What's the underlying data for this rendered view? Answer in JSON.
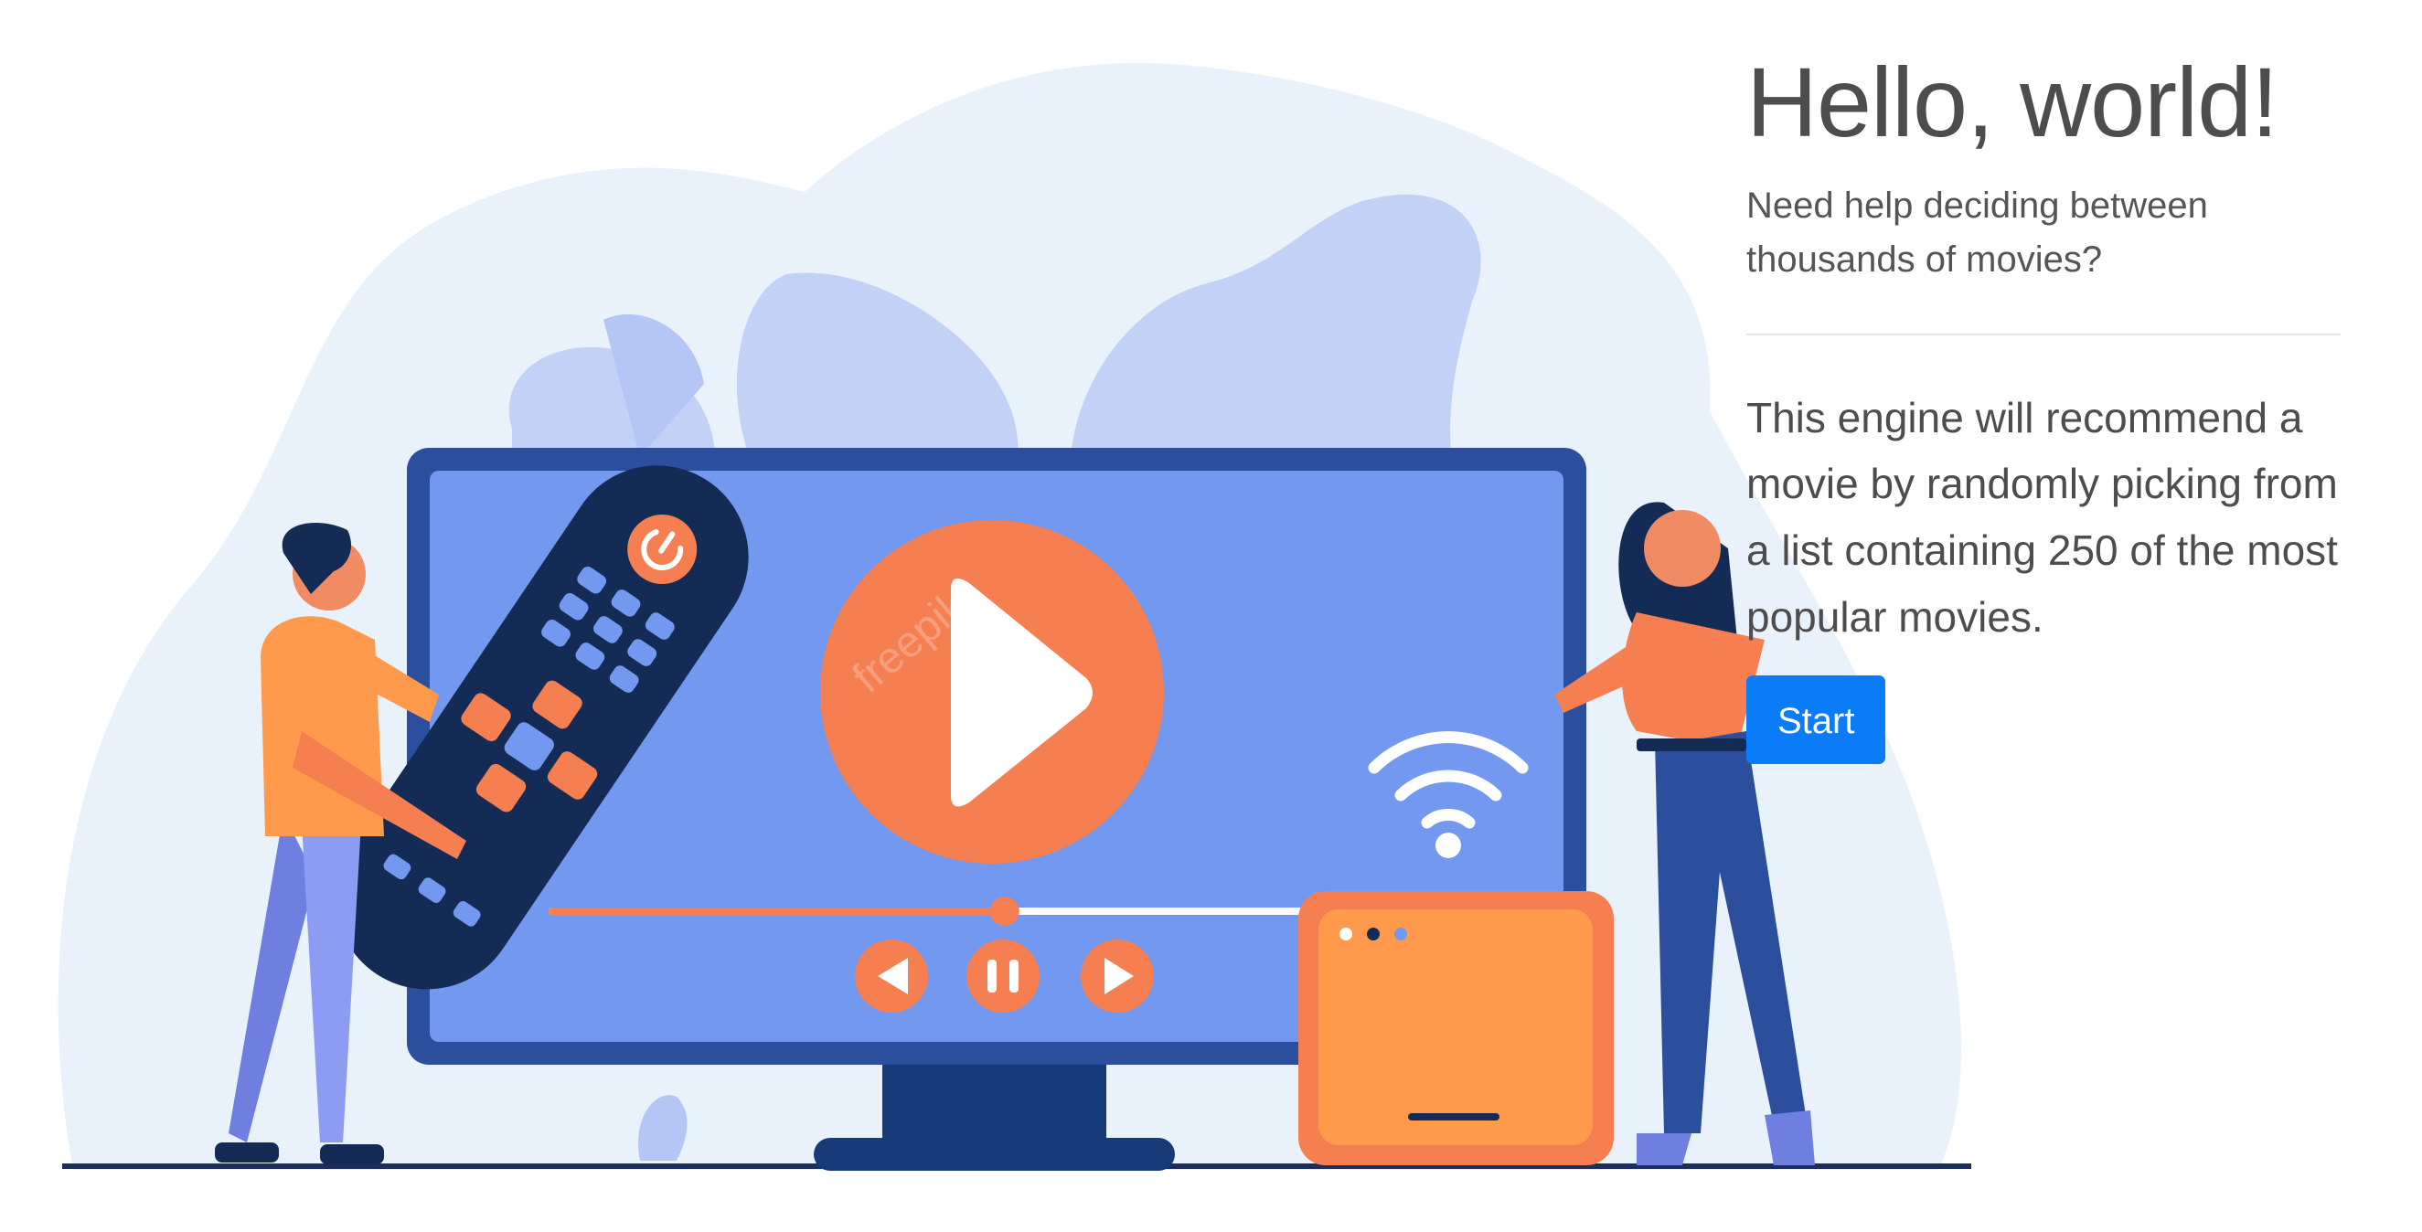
{
  "hero": {
    "title": "Hello, world!",
    "lead": "Need help deciding between thousands of movies?",
    "body": "This engine will recommend a movie by randomly picking from a list containing 250 of the most popular movies.",
    "start_label": "Start",
    "watermark": "freepik"
  },
  "colors": {
    "button": "#0a7cf7",
    "tv_screen": "#7398ef",
    "tv_frame": "#2b4f9d",
    "play_circle": "#f57f50",
    "remote": "#142c55",
    "router": "#ff9a4d",
    "blob": "#e9f2fb",
    "leaf": "#c2d2f7"
  },
  "illustration": {
    "progress_fraction": 0.58
  }
}
